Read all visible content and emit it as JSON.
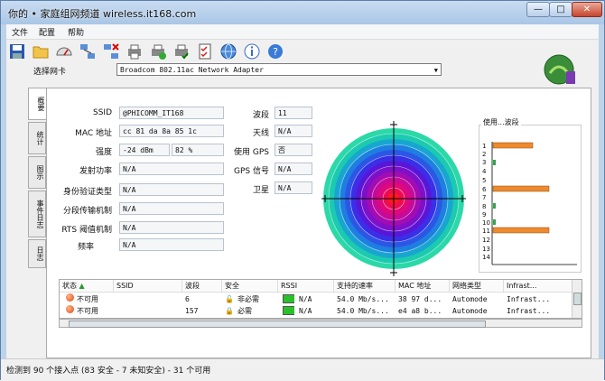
{
  "window": {
    "title": "你的 • 家庭组网频道 wireless.it168.com",
    "caption_buttons": [
      "—",
      "□",
      "✕"
    ]
  },
  "menu": [
    "文件",
    "配置",
    "帮助"
  ],
  "toolbar_icons": [
    "save-icon",
    "folder-icon",
    "gauge-icon",
    "network-icon",
    "network-remove-icon",
    "printer-icon",
    "printer-add-icon",
    "printer-check-icon",
    "checklist-icon",
    "globe-icon",
    "info-icon",
    "help-icon"
  ],
  "adapter": {
    "label": "选择网卡",
    "selected": "Broadcom 802.11ac Network Adapter"
  },
  "tabs": [
    "概要",
    "统计",
    "图示",
    "事件日志",
    "日志"
  ],
  "summary": {
    "ssid_label": "SSID",
    "ssid": "@PHICOMM_IT168",
    "mac_label": "MAC 地址",
    "mac": "cc 81 da 8a 85 1c",
    "strength_label": "强度",
    "strength_dbm": "-24 dBm",
    "strength_pct": "82 %",
    "txpower_label": "发射功率",
    "txpower": "N/A",
    "auth_label": "身份验证类型",
    "auth": "N/A",
    "frag_label": "分段传输机制",
    "frag": "N/A",
    "rts_label": "RTS 阈值机制",
    "rts": "N/A",
    "freq_label": "频率",
    "freq": "N/A",
    "channel_label": "波段",
    "channel": "11",
    "antenna_label": "天线",
    "antenna": "N/A",
    "usegps_label": "使用 GPS",
    "usegps": "否",
    "gps_label": "GPS 信号",
    "gps": "N/A",
    "sat_label": "卫星",
    "sat": "N/A"
  },
  "channel_usage": {
    "title": "使用...波段",
    "channels": [
      "1",
      "2",
      "3",
      "4",
      "5",
      "6",
      "7",
      "8",
      "9",
      "10",
      "11",
      "12",
      "13",
      "14"
    ]
  },
  "table": {
    "headers": [
      "状态",
      "SSID",
      "波段",
      "安全",
      "RSSI",
      "支持的速率",
      "MAC 地址",
      "网络类型",
      "Infrast..."
    ],
    "rows": [
      {
        "status": "不可用",
        "ssid": "",
        "channel": "6",
        "security": "非必需",
        "rssi": "N/A",
        "rate": "54.0 Mb/s...",
        "mac": "38 97 d...",
        "type": "Automode",
        "infra": "Infrast..."
      },
      {
        "status": "不可用",
        "ssid": "",
        "channel": "157",
        "security": "必需",
        "rssi": "N/A",
        "rate": "54.0 Mb/s...",
        "mac": "e4 a8 b...",
        "type": "Automode",
        "infra": "Infrast..."
      }
    ]
  },
  "status": "检测到 90 个接入点 (83 安全 - 7 未知安全) - 31 个可用",
  "colors": {
    "accent": "#ee8a2e",
    "window": "#bcd3ea"
  }
}
